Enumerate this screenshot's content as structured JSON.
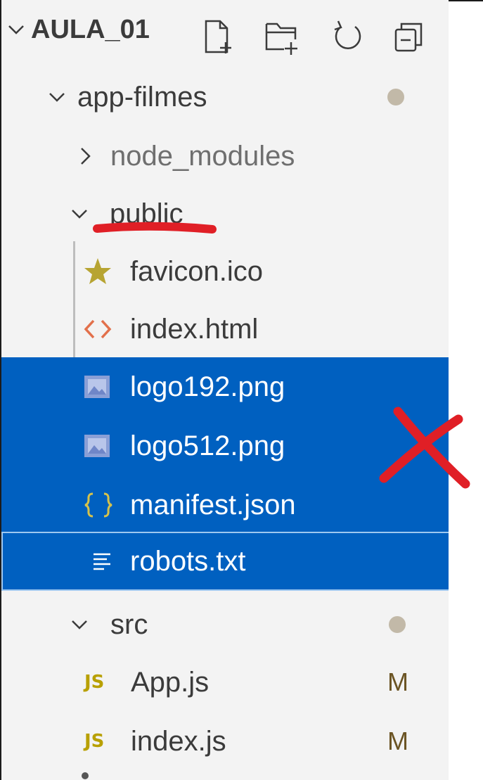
{
  "explorer": {
    "title": "AULA_01",
    "toolbar": {
      "new_file_icon": "new-file-icon",
      "new_folder_icon": "new-folder-icon",
      "refresh_icon": "refresh-icon",
      "collapse_icon": "collapse-all-icon"
    }
  },
  "tree": {
    "app_filmes": "app-filmes",
    "node_modules": "node_modules",
    "public": "public",
    "favicon": "favicon.ico",
    "index_html": "index.html",
    "logo192": "logo192.png",
    "logo512": "logo512.png",
    "manifest": "manifest.json",
    "robots": "robots.txt",
    "src": "src",
    "app_js": "App.js",
    "index_js": "index.js",
    "js_badge": "JS",
    "app_js_status": "M",
    "index_js_status": "M"
  },
  "colors": {
    "selection": "#0060c0",
    "annotation_red": "#e01f26",
    "modified_badge": "#6b5424"
  }
}
